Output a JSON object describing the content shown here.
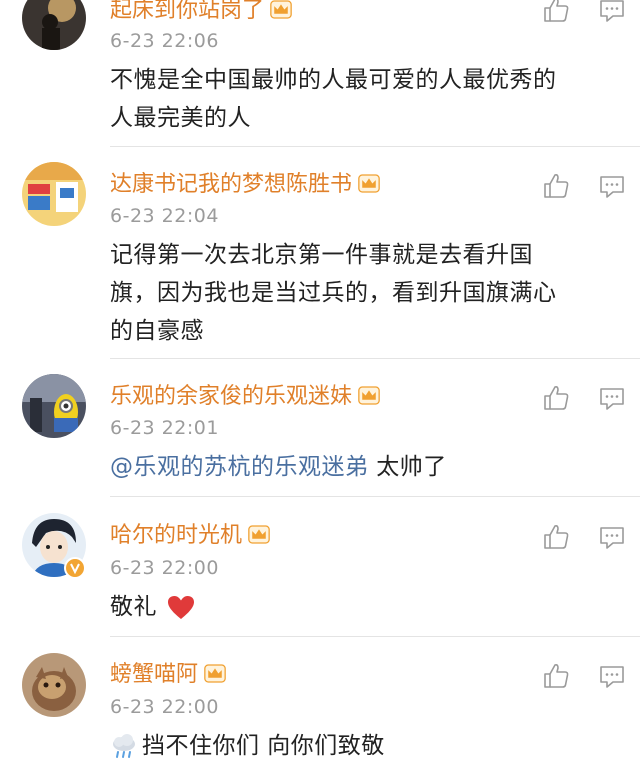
{
  "comments": [
    {
      "user": "起床到你站岗了",
      "time": "6-23 22:06",
      "text_lines": [
        "不愧是全中国最帅的人最可爱的人最优秀的",
        "人最完美的人"
      ]
    },
    {
      "user": "达康书记我的梦想陈胜书",
      "time": "6-23 22:04",
      "text_lines": [
        "记得第一次去北京第一件事就是去看升国",
        "旗，因为我也是当过兵的，看到升国旗满心",
        "的自豪感"
      ]
    },
    {
      "user": "乐观的余家俊的乐观迷妹",
      "time": "6-23 22:01",
      "mention": "@乐观的苏杭的乐观迷弟",
      "text": " 太帅了"
    },
    {
      "user": "哈尔的时光机",
      "time": "6-23 22:00",
      "text": "敬礼"
    },
    {
      "user": "螃蟹喵阿",
      "time": "6-23 22:00",
      "text": "挡不住你们 向你们致敬"
    }
  ],
  "colors": {
    "username": "#e0802a",
    "mention": "#4a6fa0",
    "time": "#9b9b9b",
    "text": "#222222",
    "heart": "#e03a3a",
    "crown": "#f0a030",
    "verified_badge": "#f2a533"
  },
  "icons": {
    "like": "thumbs-up-icon",
    "reply": "comment-icon",
    "member": "crown-icon",
    "heart": "heart-emoji-icon",
    "rain": "rain-cloud-emoji-icon"
  }
}
